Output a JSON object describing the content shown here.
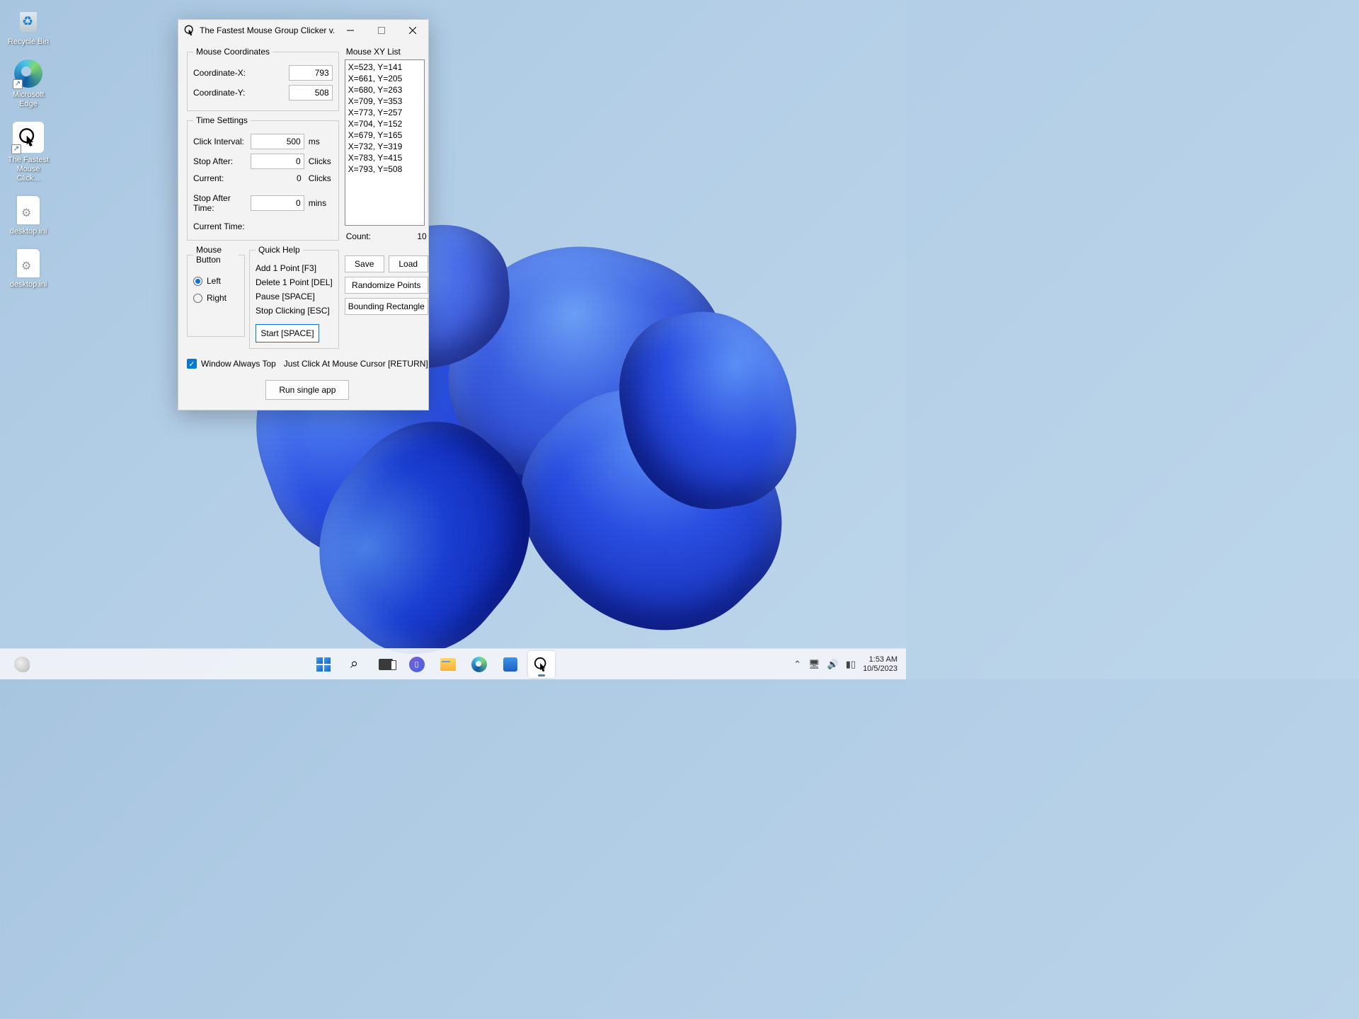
{
  "desktop": {
    "icons": [
      {
        "label": "Recycle Bin"
      },
      {
        "label": "Microsoft Edge"
      },
      {
        "label": "The Fastest Mouse Click..."
      },
      {
        "label": "desktop.ini"
      },
      {
        "label": "desktop.ini"
      }
    ]
  },
  "window": {
    "title": "The Fastest Mouse Group Clicker v...",
    "coords": {
      "legend": "Mouse Coordinates",
      "x_label": "Coordinate-X:",
      "x_value": "793",
      "y_label": "Coordinate-Y:",
      "y_value": "508"
    },
    "time": {
      "legend": "Time Settings",
      "interval_label": "Click Interval:",
      "interval_value": "500",
      "interval_unit": "ms",
      "stop_after_label": "Stop After:",
      "stop_after_value": "0",
      "stop_after_unit": "Clicks",
      "current_label": "Current:",
      "current_value": "0",
      "current_unit": "Clicks",
      "stop_after_time_label": "Stop After Time:",
      "stop_after_time_value": "0",
      "stop_after_time_unit": "mins",
      "current_time_label": "Current Time:"
    },
    "mouse_button": {
      "legend": "Mouse Button",
      "left": "Left",
      "right": "Right",
      "selected": "Left"
    },
    "help": {
      "legend": "Quick Help",
      "add": "Add 1 Point [F3]",
      "delete": "Delete 1 Point [DEL]",
      "pause": "Pause [SPACE]",
      "stop": "Stop Clicking [ESC]",
      "start": "Start [SPACE]"
    },
    "list": {
      "label": "Mouse XY List",
      "items": [
        "X=523, Y=141",
        "X=661, Y=205",
        "X=680, Y=263",
        "X=709, Y=353",
        "X=773, Y=257",
        "X=704, Y=152",
        "X=679, Y=165",
        "X=732, Y=319",
        "X=783, Y=415",
        "X=793, Y=508"
      ],
      "count_label": "Count:",
      "count_value": "10"
    },
    "buttons": {
      "save": "Save",
      "load": "Load",
      "randomize": "Randomize Points",
      "bounding": "Bounding Rectangle"
    },
    "always_top": "Window Always Top",
    "return_hint": "Just Click At Mouse Cursor [RETURN]",
    "run_single": "Run single app"
  },
  "taskbar": {
    "time": "1:53 AM",
    "date": "10/5/2023"
  }
}
